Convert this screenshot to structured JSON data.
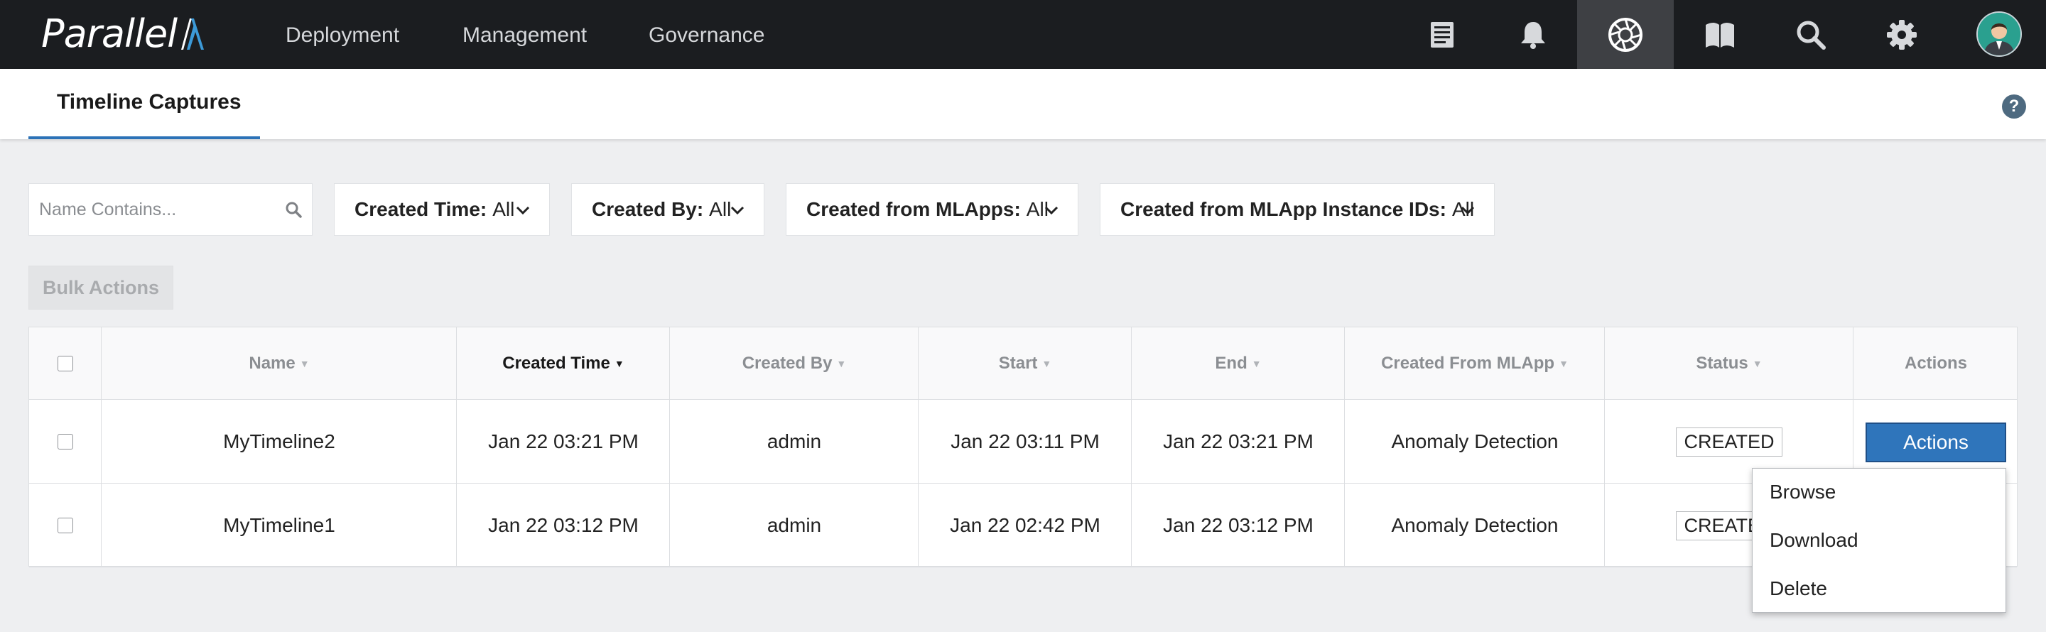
{
  "brand": {
    "name": "Parallel"
  },
  "nav": {
    "links": [
      "Deployment",
      "Management",
      "Governance"
    ],
    "icons": [
      "docs-icon",
      "bell-icon",
      "aperture-icon",
      "book-icon",
      "search-icon",
      "gear-icon"
    ]
  },
  "subheader": {
    "tab": "Timeline Captures",
    "help": "?"
  },
  "filters": {
    "search_placeholder": "Name Contains...",
    "items": [
      {
        "label": "Created Time:",
        "value": "All"
      },
      {
        "label": "Created By:",
        "value": "All"
      },
      {
        "label": "Created from MLApps:",
        "value": "All"
      },
      {
        "label": "Created from MLApp Instance IDs:",
        "value": "All"
      }
    ]
  },
  "bulk_actions": "Bulk Actions",
  "table": {
    "columns": [
      "Name",
      "Created Time",
      "Created By",
      "Start",
      "End",
      "Created From MLApp",
      "Status",
      "Actions"
    ],
    "sorted_column": "Created Time",
    "rows": [
      {
        "name": "MyTimeline2",
        "created_time": "Jan 22 03:21 PM",
        "created_by": "admin",
        "start": "Jan 22 03:11 PM",
        "end": "Jan 22 03:21 PM",
        "mlapp": "Anomaly Detection",
        "status": "CREATED"
      },
      {
        "name": "MyTimeline1",
        "created_time": "Jan 22 03:12 PM",
        "created_by": "admin",
        "start": "Jan 22 02:42 PM",
        "end": "Jan 22 03:12 PM",
        "mlapp": "Anomaly Detection",
        "status": "CREATED"
      }
    ],
    "actions_button": "Actions"
  },
  "actions_menu": {
    "items": [
      "Browse",
      "Download",
      "Delete"
    ]
  },
  "colors": {
    "nav_bg": "#1b1d20",
    "accent": "#2f75bb",
    "page_bg": "#eeeff1"
  }
}
